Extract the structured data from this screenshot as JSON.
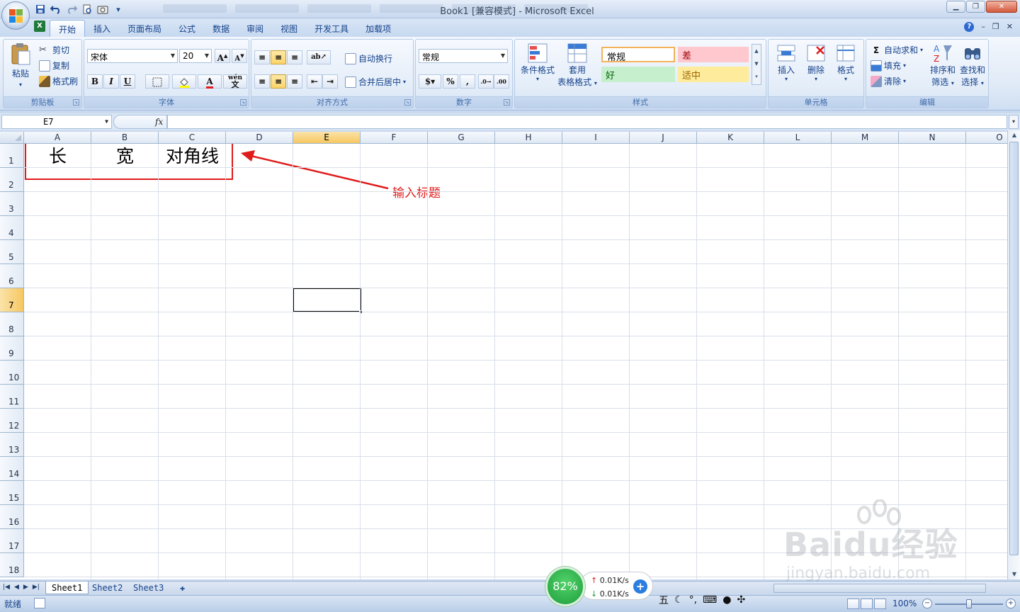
{
  "window": {
    "title": "Book1  [兼容模式] - Microsoft Excel"
  },
  "quick_access": [
    "save-icon",
    "undo-icon",
    "redo-icon",
    "print-preview-icon",
    "camera-icon",
    "customize-icon"
  ],
  "ribbon_tabs": [
    {
      "label": "开始",
      "active": true
    },
    {
      "label": "插入"
    },
    {
      "label": "页面布局"
    },
    {
      "label": "公式"
    },
    {
      "label": "数据"
    },
    {
      "label": "审阅"
    },
    {
      "label": "视图"
    },
    {
      "label": "开发工具"
    },
    {
      "label": "加载项"
    }
  ],
  "clipboard": {
    "paste": "粘贴",
    "cut": "剪切",
    "copy": "复制",
    "format_painter": "格式刷",
    "label": "剪贴板"
  },
  "font": {
    "name": "宋体",
    "size": "20",
    "bold": "B",
    "italic": "I",
    "underline": "U",
    "label": "字体",
    "grow": "A",
    "shrink": "A",
    "phonetic": "wén"
  },
  "alignment": {
    "wrap": "自动换行",
    "merge": "合并后居中",
    "label": "对齐方式"
  },
  "number": {
    "format": "常规",
    "percent": "%",
    "comma": ",",
    "label": "数字"
  },
  "styles": {
    "conditional": "条件格式",
    "table_line1": "套用",
    "table_line2": "表格格式",
    "normal": "常规",
    "bad": "差",
    "good": "好",
    "neutral": "适中",
    "label": "样式"
  },
  "cells": {
    "insert": "插入",
    "delete": "删除",
    "format": "格式",
    "label": "单元格"
  },
  "editing": {
    "autosum": "自动求和",
    "fill": "填充",
    "clear": "清除",
    "sort_line1": "排序和",
    "sort_line2": "筛选",
    "find_line1": "查找和",
    "find_line2": "选择",
    "label": "编辑",
    "sigma": "Σ"
  },
  "formula_bar": {
    "name_box": "E7",
    "fx": "fx",
    "value": ""
  },
  "grid": {
    "columns": [
      "A",
      "B",
      "C",
      "D",
      "E",
      "F",
      "G",
      "H",
      "I",
      "J",
      "K",
      "L",
      "M",
      "N",
      "O"
    ],
    "rows": [
      "1",
      "2",
      "3",
      "4",
      "5",
      "6",
      "7",
      "8",
      "9",
      "10",
      "11",
      "12",
      "13",
      "14",
      "15",
      "16",
      "17",
      "18"
    ],
    "active_column": "E",
    "active_row": "7",
    "row1": {
      "A": "长",
      "B": "宽",
      "C": "对角线"
    }
  },
  "annotation": {
    "text": "输入标题"
  },
  "sheets": [
    "Sheet1",
    "Sheet2",
    "Sheet3"
  ],
  "status": {
    "ready": "就绪",
    "zoom": "100%"
  },
  "speed_widget": {
    "percent": "82%",
    "upload": "0.01K/s",
    "download": "0.01K/s"
  },
  "ime": {
    "mode": "五"
  },
  "watermark": {
    "brand": "Baidu经验",
    "url": "jingyan.baidu.com"
  },
  "colors": {
    "accent": "#15428b",
    "annotation_red": "#e01b1b",
    "selection": "#f6c760"
  }
}
